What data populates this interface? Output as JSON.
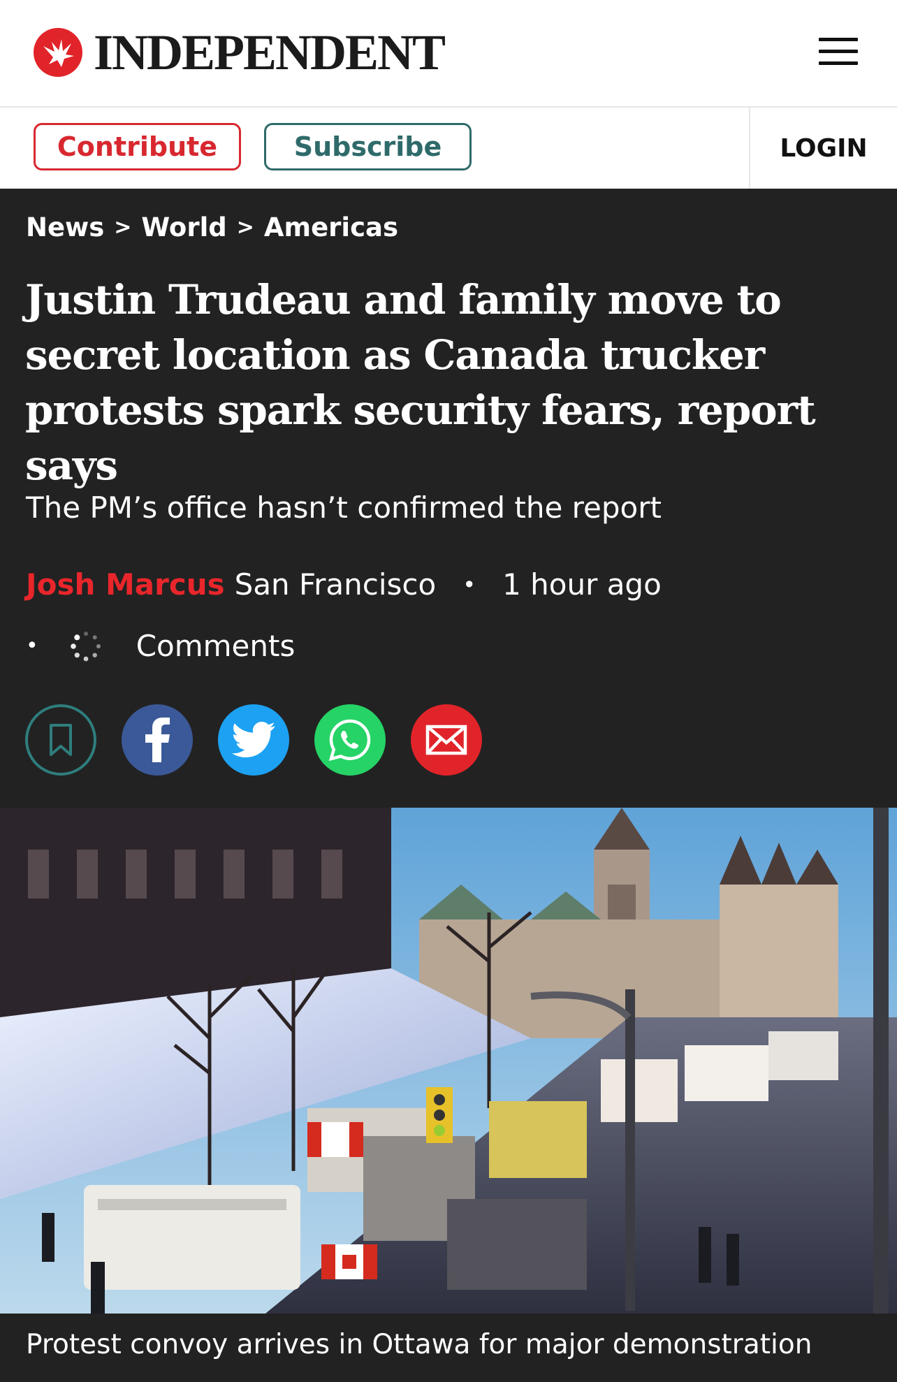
{
  "header": {
    "logo_text": "INDEPENDENT",
    "brand_color": "#e1242a",
    "menu_icon": "hamburger-menu-icon"
  },
  "subnav": {
    "contribute_label": "Contribute",
    "subscribe_label": "Subscribe",
    "login_label": "LOGIN"
  },
  "breadcrumb": [
    "News",
    "World",
    "Americas"
  ],
  "article": {
    "headline": "Justin Trudeau and family move to secret location as Canada trucker protests spark security fears, report says",
    "standfirst": "The PM’s office hasn’t confirmed the report",
    "author": "Josh Marcus",
    "location": "San Francisco",
    "time": "1 hour ago",
    "comments_label": "Comments"
  },
  "share": {
    "icons": [
      "bookmark-icon",
      "facebook-icon",
      "twitter-icon",
      "whatsapp-icon",
      "email-icon"
    ]
  },
  "hero": {
    "caption": "Protest convoy arrives in Ottawa for major demonstration"
  }
}
